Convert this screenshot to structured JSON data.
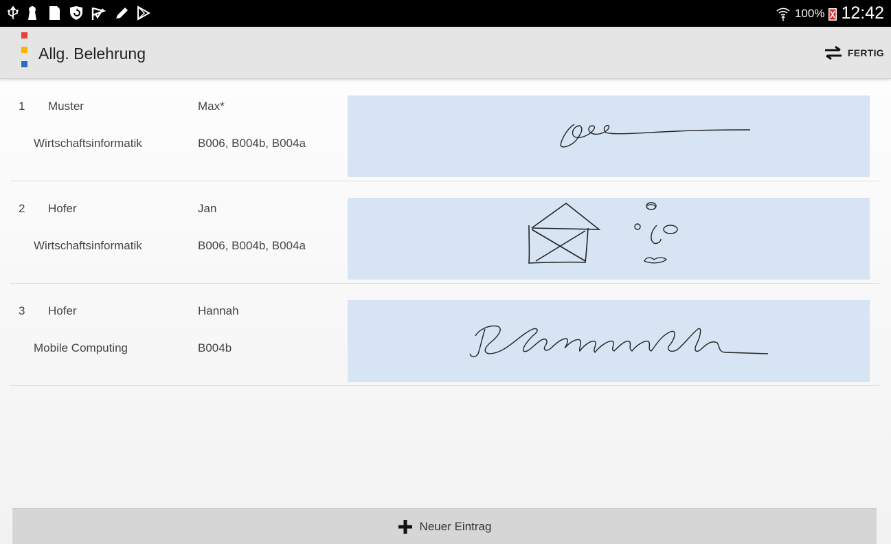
{
  "status_bar": {
    "battery": "100%",
    "time": "12:42",
    "left_icons": [
      "usb-icon",
      "keyhole-icon",
      "document-icon",
      "shield-refresh-icon",
      "check-flag-icon",
      "pencil-icon",
      "play-store-icon"
    ],
    "right_icons": [
      "wifi-icon",
      "battery-icon"
    ]
  },
  "action_bar": {
    "title": "Allg. Belehrung",
    "done_label": "FERTIG",
    "logo_colors": [
      "#e8413a",
      "#f5b400",
      "#2c6cc4"
    ]
  },
  "entries": [
    {
      "number": "1",
      "last_name": "Muster",
      "first_name": "Max*",
      "course": "Wirtschaftsinformatik",
      "rooms": "B006, B004b, B004a",
      "signature": "scribble"
    },
    {
      "number": "2",
      "last_name": "Hofer",
      "first_name": "Jan",
      "course": "Wirtschaftsinformatik",
      "rooms": "B006, B004b, B004a",
      "signature": "house-and-face-drawing"
    },
    {
      "number": "3",
      "last_name": "Hofer",
      "first_name": "Hannah",
      "course": "Mobile Computing",
      "rooms": "B004b",
      "signature": "cursive-hannah"
    }
  ],
  "new_entry_label": "Neuer Eintrag",
  "colors": {
    "signature_bg": "#d6e4f3",
    "action_bar_bg": "#e5e5e5",
    "status_bar_bg": "#000000"
  }
}
